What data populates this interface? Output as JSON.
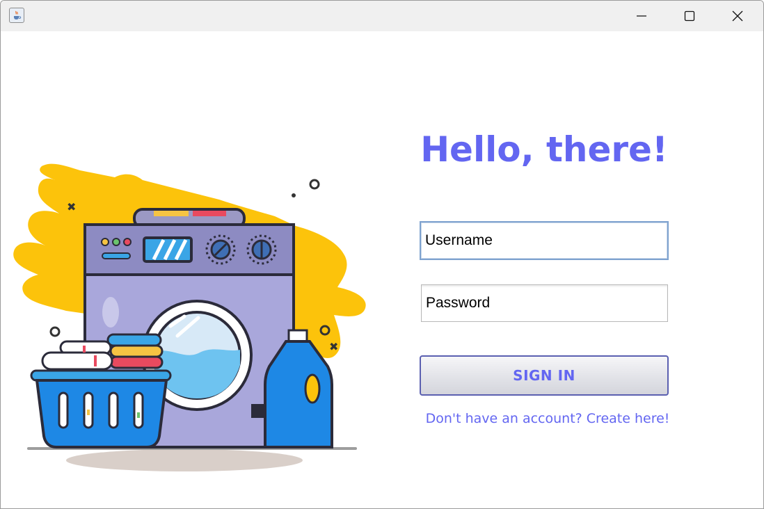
{
  "window": {
    "controls": {
      "minimize": "minimize-icon",
      "maximize": "maximize-icon",
      "close": "close-icon"
    }
  },
  "login": {
    "heading": "Hello, there!",
    "username_value": "Username",
    "password_value": "Password",
    "signin_label": "SIGN IN",
    "create_account_link": "Don't have an account? Create here!"
  },
  "colors": {
    "accent": "#6366f1",
    "titlebar": "#f0f0f0",
    "splash": "#fcc30b",
    "washer_body": "#a9a7db",
    "basket": "#1e88e5"
  },
  "icons": {
    "app": "java-cup-icon",
    "illustration": "washing-machine-illustration"
  }
}
